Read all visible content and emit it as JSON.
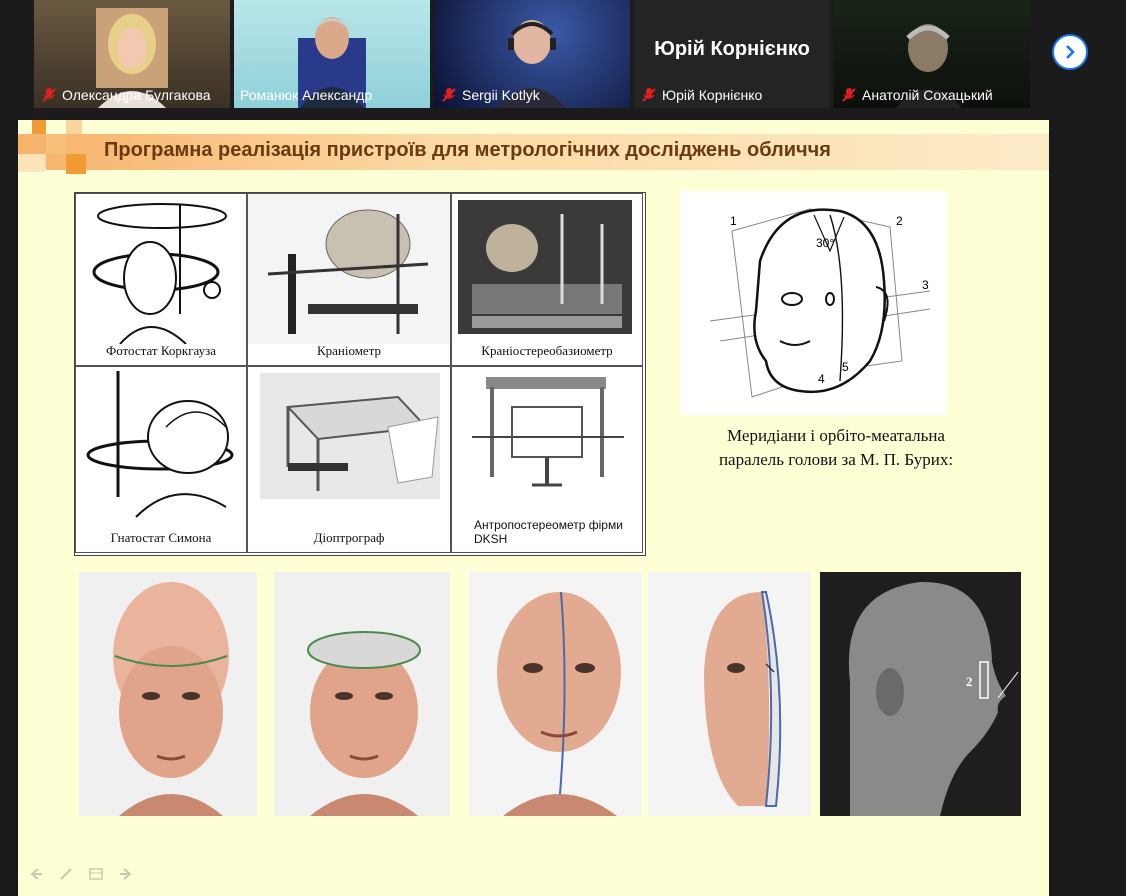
{
  "participants": [
    {
      "name": "Олександра Булгакова",
      "muted": true,
      "active": false,
      "big_label": ""
    },
    {
      "name": "Романюк Александр",
      "muted": false,
      "active": true,
      "big_label": ""
    },
    {
      "name": "Sergii Kotlyk",
      "muted": true,
      "active": false,
      "big_label": ""
    },
    {
      "name": "Юрій Корнієнко",
      "muted": true,
      "active": false,
      "big_label": "Юрій Корнієнко"
    },
    {
      "name": "Анатолій Сохацький",
      "muted": true,
      "active": false,
      "big_label": ""
    }
  ],
  "slide": {
    "title": "Програмна реалізація пристроїв для метрологічних досліджень обличчя",
    "devices": [
      "Фотостат Коркгауза",
      "Краніометр",
      "Краніостереобазиометр",
      "Гнатостат Симона",
      "Діоптрограф",
      "Антропостереометр фірми DKSH"
    ],
    "meridian_labels": [
      "1",
      "2",
      "3",
      "4",
      "5",
      "30°"
    ],
    "meridian_caption_line1": "Меридіани і орбіто-меатальна",
    "meridian_caption_line2": "паралель голови за   М. П. Бурих:",
    "profile_label": "2"
  },
  "colors": {
    "active_border": "#23d160",
    "muted_mic": "#e02020",
    "slide_bg": "#ffffd6",
    "title_text": "#6a3a10",
    "title_accent": "#f29b35"
  },
  "icons": [
    "mic-muted-icon",
    "chevron-right-icon",
    "prev-slide-icon",
    "pen-icon",
    "menu-icon",
    "next-slide-icon"
  ]
}
